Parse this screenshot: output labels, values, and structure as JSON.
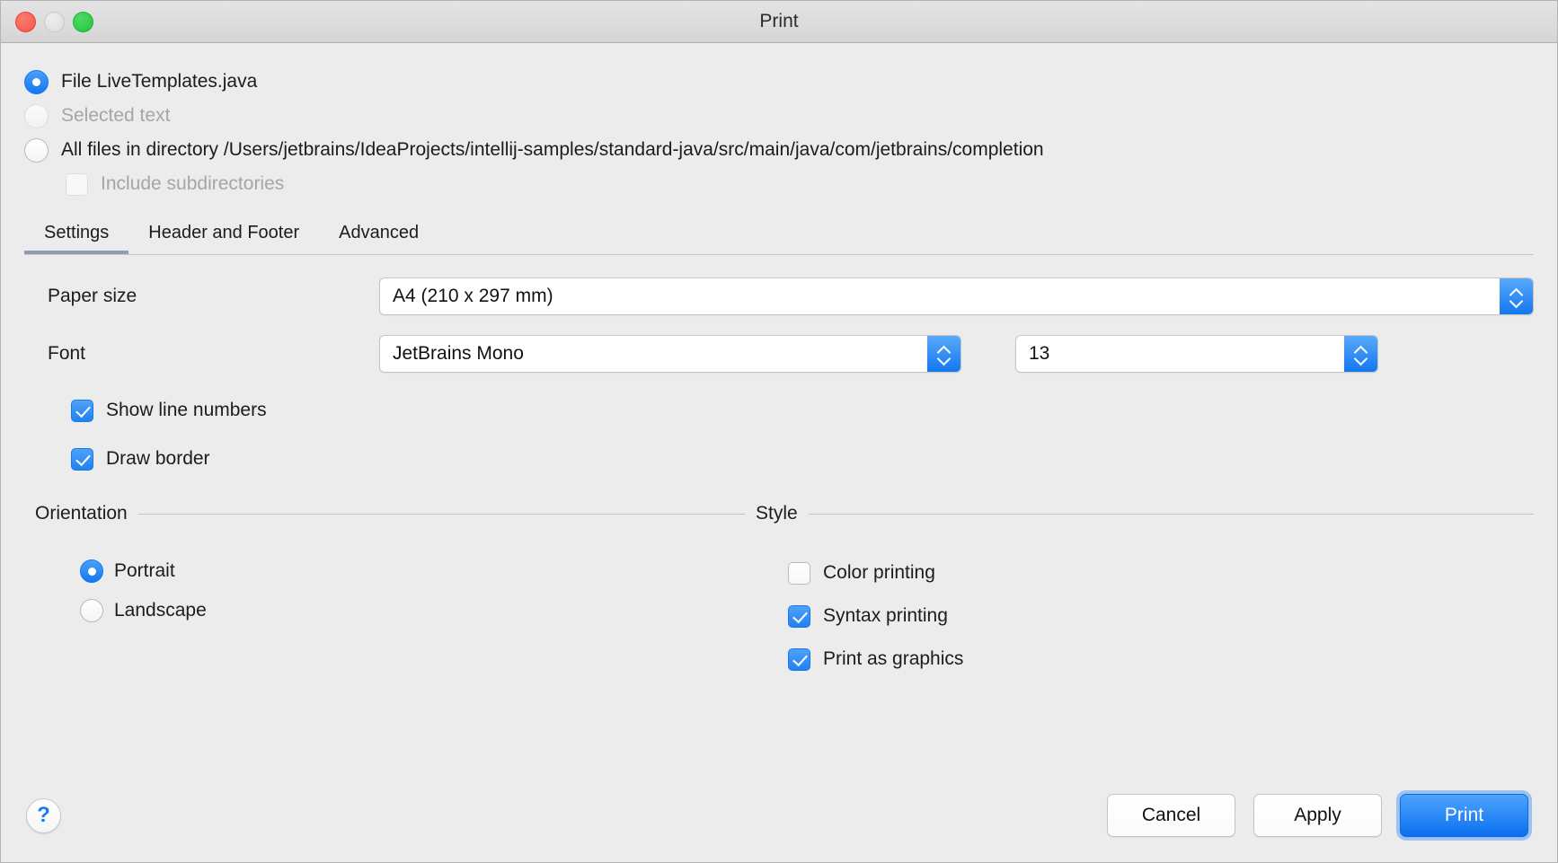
{
  "window": {
    "title": "Print",
    "traffic_lights": [
      "close",
      "minimize",
      "maximize"
    ]
  },
  "scope": {
    "options": [
      {
        "label": "File LiveTemplates.java",
        "selected": true,
        "disabled": false
      },
      {
        "label": "Selected text",
        "selected": false,
        "disabled": true
      },
      {
        "label": "All files in directory /Users/jetbrains/IdeaProjects/intellij-samples/standard-java/src/main/java/com/jetbrains/completion",
        "selected": false,
        "disabled": false
      }
    ],
    "include_subdirectories": {
      "label": "Include subdirectories",
      "checked": false,
      "disabled": true
    }
  },
  "tabs": [
    {
      "label": "Settings",
      "active": true
    },
    {
      "label": "Header and Footer",
      "active": false
    },
    {
      "label": "Advanced",
      "active": false
    }
  ],
  "settings": {
    "paper_size": {
      "label": "Paper size",
      "value": "A4    (210 x 297 mm)"
    },
    "font": {
      "label": "Font",
      "value": "JetBrains Mono"
    },
    "font_size": {
      "value": "13"
    },
    "show_line_numbers": {
      "label": "Show line numbers",
      "checked": true
    },
    "draw_border": {
      "label": "Draw border",
      "checked": true
    }
  },
  "orientation": {
    "title": "Orientation",
    "options": [
      {
        "label": "Portrait",
        "selected": true
      },
      {
        "label": "Landscape",
        "selected": false
      }
    ]
  },
  "style": {
    "title": "Style",
    "options": [
      {
        "label": "Color printing",
        "checked": false
      },
      {
        "label": "Syntax printing",
        "checked": true
      },
      {
        "label": "Print as graphics",
        "checked": true
      }
    ]
  },
  "footer": {
    "help_label": "?",
    "cancel_label": "Cancel",
    "apply_label": "Apply",
    "print_label": "Print"
  },
  "colors": {
    "accent_blue": "#1478f0",
    "window_bg": "#ececec",
    "tab_underline": "#8e9cb4",
    "disabled_text": "#a6a6a6"
  }
}
